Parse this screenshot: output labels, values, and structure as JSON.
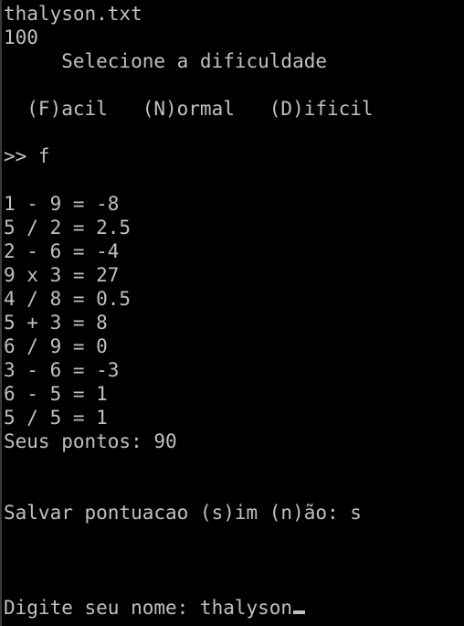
{
  "terminal": {
    "lines": [
      "thalyson.txt",
      "100",
      "     Selecione a dificuldade",
      "",
      "  (F)acil   (N)ormal   (D)ificil",
      "",
      ">> f",
      "",
      "1 - 9 = -8",
      "5 / 2 = 2.5",
      "2 - 6 = -4",
      "9 x 3 = 27",
      "4 / 8 = 0.5",
      "5 + 3 = 8",
      "6 / 9 = 0",
      "3 - 6 = -3",
      "6 - 5 = 1",
      "5 / 5 = 1",
      "Seus pontos: 90",
      "",
      "",
      "Salvar pontuacao (s)im (n)ão: s",
      "",
      "",
      "",
      "Digite seu nome: thalyson"
    ],
    "colors": {
      "background": "#000000",
      "text": "#c0c0c0"
    }
  }
}
